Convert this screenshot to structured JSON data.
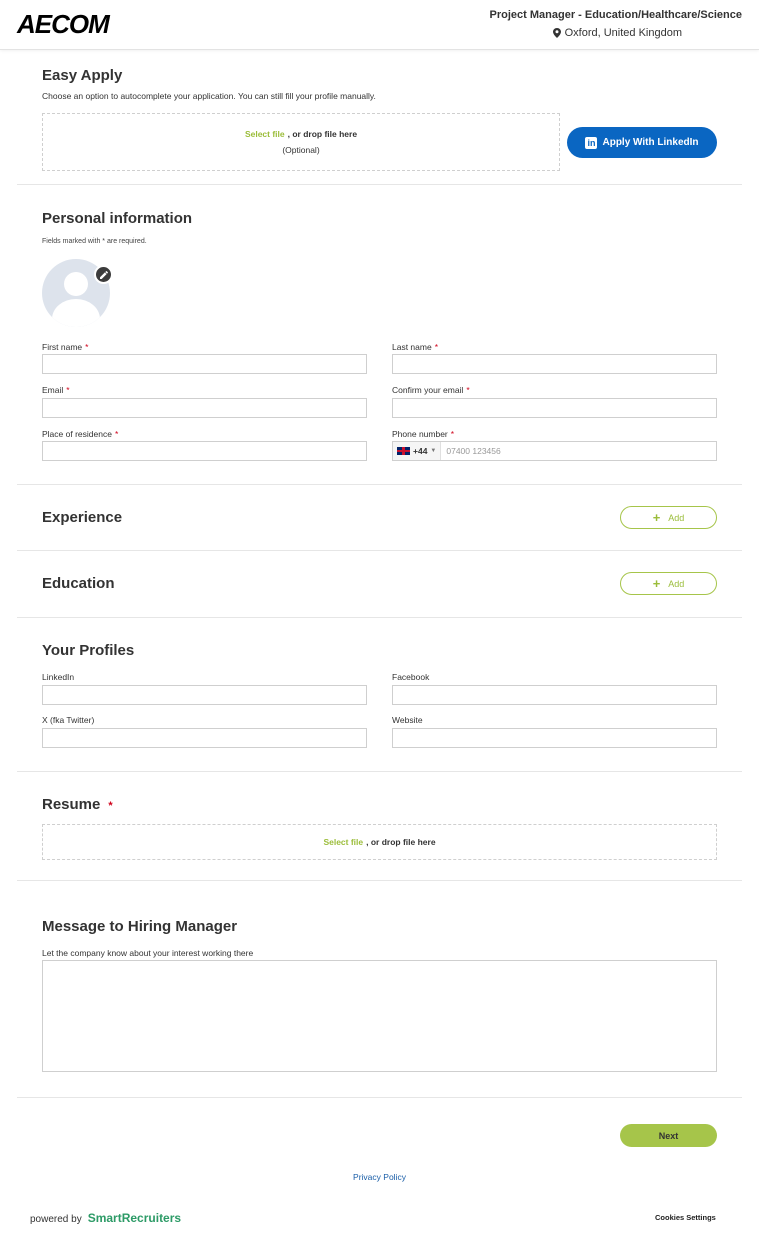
{
  "header": {
    "logo": "AECOM",
    "job_title": "Project Manager - Education/Healthcare/Science",
    "location": "Oxford, United Kingdom"
  },
  "easy_apply": {
    "title": "Easy Apply",
    "description": "Choose an option to autocomplete your application. You can still fill your profile manually.",
    "select_file": "Select file",
    "drop_text": ", or drop file here",
    "optional": "(Optional)",
    "linkedin_button": "Apply With LinkedIn"
  },
  "personal": {
    "title": "Personal information",
    "required_note": "Fields marked with * are required.",
    "first_name_label": "First name",
    "last_name_label": "Last name",
    "email_label": "Email",
    "confirm_email_label": "Confirm your email",
    "residence_label": "Place of residence",
    "phone_label": "Phone number",
    "phone_code": "+44",
    "phone_placeholder": "07400 123456",
    "required_mark": "*"
  },
  "experience": {
    "title": "Experience",
    "add_label": "Add"
  },
  "education": {
    "title": "Education",
    "add_label": "Add"
  },
  "profiles": {
    "title": "Your Profiles",
    "linkedin_label": "LinkedIn",
    "facebook_label": "Facebook",
    "twitter_label": "X (fka Twitter)",
    "website_label": "Website"
  },
  "resume": {
    "title": "Resume",
    "required_mark": "*",
    "select_file": "Select file",
    "drop_text": ", or drop file here"
  },
  "message": {
    "title": "Message to Hiring Manager",
    "description": "Let the company know about your interest working there"
  },
  "footer": {
    "next": "Next",
    "privacy": "Privacy Policy",
    "powered_by": "powered by",
    "brand": "SmartRecruiters",
    "cookies": "Cookies Settings"
  },
  "colors": {
    "accent_green": "#a6c54a",
    "linkedin_blue": "#0a66c2",
    "required_red": "#d0021b",
    "link_blue": "#1a5ea8"
  }
}
